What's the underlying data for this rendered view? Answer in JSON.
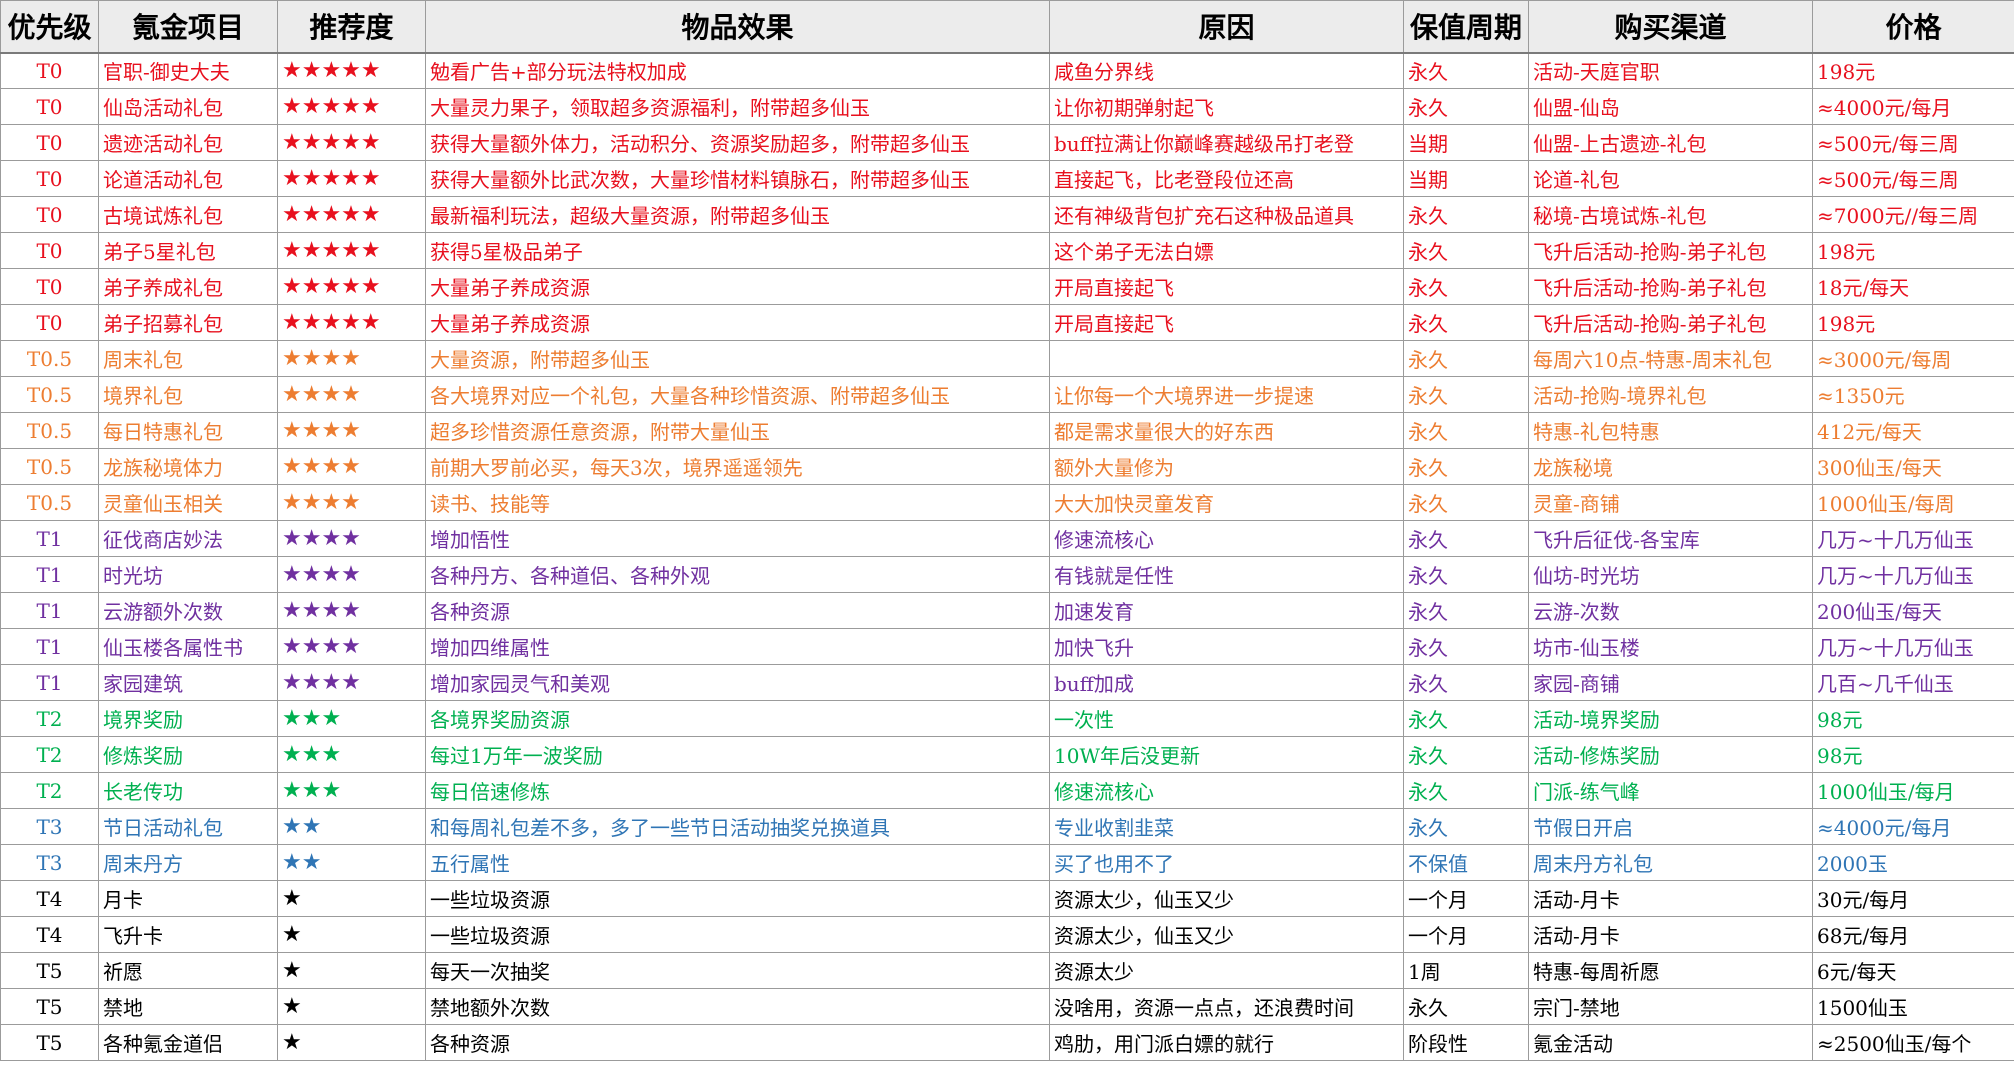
{
  "colors": {
    "T0": "#e8101e",
    "T0.5": "#ed7d31",
    "T1": "#7030a0",
    "T2": "#00b050",
    "T3": "#2f75b5",
    "T4": "#000000",
    "T5": "#000000"
  },
  "headers": [
    "优先级",
    "氪金项目",
    "推荐度",
    "物品效果",
    "原因",
    "保值周期",
    "购买渠道",
    "价格"
  ],
  "rows": [
    {
      "tier": "T0",
      "item": "官职-御史大夫",
      "stars": "★★★★★",
      "effect": "勉看广告+部分玩法特权加成",
      "reason": "咸鱼分界线",
      "period": "永久",
      "channel": "活动-天庭官职",
      "price": "198元"
    },
    {
      "tier": "T0",
      "item": "仙岛活动礼包",
      "stars": "★★★★★",
      "effect": "大量灵力果子，领取超多资源福利，附带超多仙玉",
      "reason": "让你初期弹射起飞",
      "period": "永久",
      "channel": "仙盟-仙岛",
      "price": "≈4000元/每月"
    },
    {
      "tier": "T0",
      "item": "遗迹活动礼包",
      "stars": "★★★★★",
      "effect": "获得大量额外体力，活动积分、资源奖励超多，附带超多仙玉",
      "reason": "buff拉满让你巅峰赛越级吊打老登",
      "period": "当期",
      "channel": "仙盟-上古遗迹-礼包",
      "price": "≈500元/每三周"
    },
    {
      "tier": "T0",
      "item": "论道活动礼包",
      "stars": "★★★★★",
      "effect": "获得大量额外比武次数，大量珍惜材料镇脉石，附带超多仙玉",
      "reason": "直接起飞，比老登段位还高",
      "period": "当期",
      "channel": "论道-礼包",
      "price": "≈500元/每三周"
    },
    {
      "tier": "T0",
      "item": "古境试炼礼包",
      "stars": "★★★★★",
      "effect": "最新福利玩法，超级大量资源，附带超多仙玉",
      "reason": "还有神级背包扩充石这种极品道具",
      "period": "永久",
      "channel": "秘境-古境试炼-礼包",
      "price": "≈7000元//每三周"
    },
    {
      "tier": "T0",
      "item": "弟子5星礼包",
      "stars": "★★★★★",
      "effect": "获得5星极品弟子",
      "reason": "这个弟子无法白嫖",
      "period": "永久",
      "channel": "飞升后活动-抢购-弟子礼包",
      "price": "198元"
    },
    {
      "tier": "T0",
      "item": "弟子养成礼包",
      "stars": "★★★★★",
      "effect": "大量弟子养成资源",
      "reason": "开局直接起飞",
      "period": "永久",
      "channel": "飞升后活动-抢购-弟子礼包",
      "price": "18元/每天"
    },
    {
      "tier": "T0",
      "item": "弟子招募礼包",
      "stars": "★★★★★",
      "effect": "大量弟子养成资源",
      "reason": "开局直接起飞",
      "period": "永久",
      "channel": "飞升后活动-抢购-弟子礼包",
      "price": "198元"
    },
    {
      "tier": "T0.5",
      "item": "周末礼包",
      "stars": "★★★★",
      "effect": "大量资源，附带超多仙玉",
      "reason": "",
      "period": "永久",
      "channel": "每周六10点-特惠-周末礼包",
      "price": "≈3000元/每周"
    },
    {
      "tier": "T0.5",
      "item": "境界礼包",
      "stars": "★★★★",
      "effect": "各大境界对应一个礼包，大量各种珍惜资源、附带超多仙玉",
      "reason": "让你每一个大境界进一步提速",
      "period": "永久",
      "channel": "活动-抢购-境界礼包",
      "price": "≈1350元"
    },
    {
      "tier": "T0.5",
      "item": "每日特惠礼包",
      "stars": "★★★★",
      "effect": "超多珍惜资源任意资源，附带大量仙玉",
      "reason": "都是需求量很大的好东西",
      "period": "永久",
      "channel": "特惠-礼包特惠",
      "price": "412元/每天"
    },
    {
      "tier": "T0.5",
      "item": "龙族秘境体力",
      "stars": "★★★★",
      "effect": "前期大罗前必买，每天3次，境界遥遥领先",
      "reason": "额外大量修为",
      "period": "永久",
      "channel": "龙族秘境",
      "price": "300仙玉/每天"
    },
    {
      "tier": "T0.5",
      "item": "灵童仙玉相关",
      "stars": "★★★★",
      "effect": "读书、技能等",
      "reason": "大大加快灵童发育",
      "period": "永久",
      "channel": "灵童-商铺",
      "price": "1000仙玉/每周"
    },
    {
      "tier": "T1",
      "item": "征伐商店妙法",
      "stars": "★★★★",
      "effect": "增加悟性",
      "reason": "修速流核心",
      "period": "永久",
      "channel": "飞升后征伐-各宝库",
      "price": "几万~十几万仙玉"
    },
    {
      "tier": "T1",
      "item": "时光坊",
      "stars": "★★★★",
      "effect": "各种丹方、各种道侣、各种外观",
      "reason": "有钱就是任性",
      "period": "永久",
      "channel": "仙坊-时光坊",
      "price": "几万~十几万仙玉"
    },
    {
      "tier": "T1",
      "item": "云游额外次数",
      "stars": "★★★★",
      "effect": "各种资源",
      "reason": "加速发育",
      "period": "永久",
      "channel": "云游-次数",
      "price": "200仙玉/每天"
    },
    {
      "tier": "T1",
      "item": "仙玉楼各属性书",
      "stars": "★★★★",
      "effect": "增加四维属性",
      "reason": "加快飞升",
      "period": "永久",
      "channel": "坊市-仙玉楼",
      "price": "几万~十几万仙玉"
    },
    {
      "tier": "T1",
      "item": "家园建筑",
      "stars": "★★★★",
      "effect": "增加家园灵气和美观",
      "reason": "buff加成",
      "period": "永久",
      "channel": "家园-商铺",
      "price": "几百~几千仙玉"
    },
    {
      "tier": "T2",
      "item": "境界奖励",
      "stars": "★★★",
      "effect": "各境界奖励资源",
      "reason": "一次性",
      "period": "永久",
      "channel": "活动-境界奖励",
      "price": "98元"
    },
    {
      "tier": "T2",
      "item": "修炼奖励",
      "stars": "★★★",
      "effect": "每过1万年一波奖励",
      "reason": "10W年后没更新",
      "period": "永久",
      "channel": "活动-修炼奖励",
      "price": "98元"
    },
    {
      "tier": "T2",
      "item": "长老传功",
      "stars": "★★★",
      "effect": "每日倍速修炼",
      "reason": "修速流核心",
      "period": "永久",
      "channel": "门派-练气峰",
      "price": "1000仙玉/每月"
    },
    {
      "tier": "T3",
      "item": "节日活动礼包",
      "stars": "★★",
      "effect": "和每周礼包差不多，多了一些节日活动抽奖兑换道具",
      "reason": "专业收割韭菜",
      "period": "永久",
      "channel": "节假日开启",
      "price": "≈4000元/每月"
    },
    {
      "tier": "T3",
      "item": "周末丹方",
      "stars": "★★",
      "effect": "五行属性",
      "reason": "买了也用不了",
      "period": "不保值",
      "channel": "周末丹方礼包",
      "price": "2000玉"
    },
    {
      "tier": "T4",
      "item": "月卡",
      "stars": "★",
      "effect": "一些垃圾资源",
      "reason": "资源太少，仙玉又少",
      "period": "一个月",
      "channel": "活动-月卡",
      "price": "30元/每月"
    },
    {
      "tier": "T4",
      "item": "飞升卡",
      "stars": "★",
      "effect": "一些垃圾资源",
      "reason": "资源太少，仙玉又少",
      "period": "一个月",
      "channel": "活动-月卡",
      "price": "68元/每月"
    },
    {
      "tier": "T5",
      "item": "祈愿",
      "stars": "★",
      "effect": "每天一次抽奖",
      "reason": "资源太少",
      "period": "1周",
      "channel": "特惠-每周祈愿",
      "price": "6元/每天"
    },
    {
      "tier": "T5",
      "item": "禁地",
      "stars": "★",
      "effect": "禁地额外次数",
      "reason": "没啥用，资源一点点，还浪费时间",
      "period": "永久",
      "channel": "宗门-禁地",
      "price": "1500仙玉"
    },
    {
      "tier": "T5",
      "item": "各种氪金道侣",
      "stars": "★",
      "effect": "各种资源",
      "reason": "鸡肋，用门派白嫖的就行",
      "period": "阶段性",
      "channel": "氪金活动",
      "price": "≈2500仙玉/每个"
    }
  ]
}
